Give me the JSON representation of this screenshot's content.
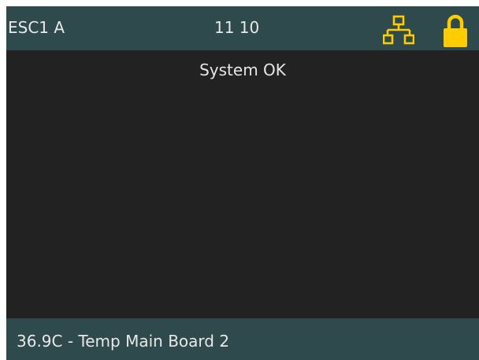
{
  "header": {
    "device_label": "ESC1 A",
    "clock": "11 10",
    "network_icon": "network-icon",
    "lock_icon": "lock-icon"
  },
  "main": {
    "status_message": "System OK"
  },
  "footer": {
    "message": "36.9C - Temp Main Board 2"
  },
  "colors": {
    "bar_background": "#2f4a4c",
    "screen_background": "#222222",
    "icon_accent": "#ffcc00",
    "text": "#e6e6e6"
  }
}
